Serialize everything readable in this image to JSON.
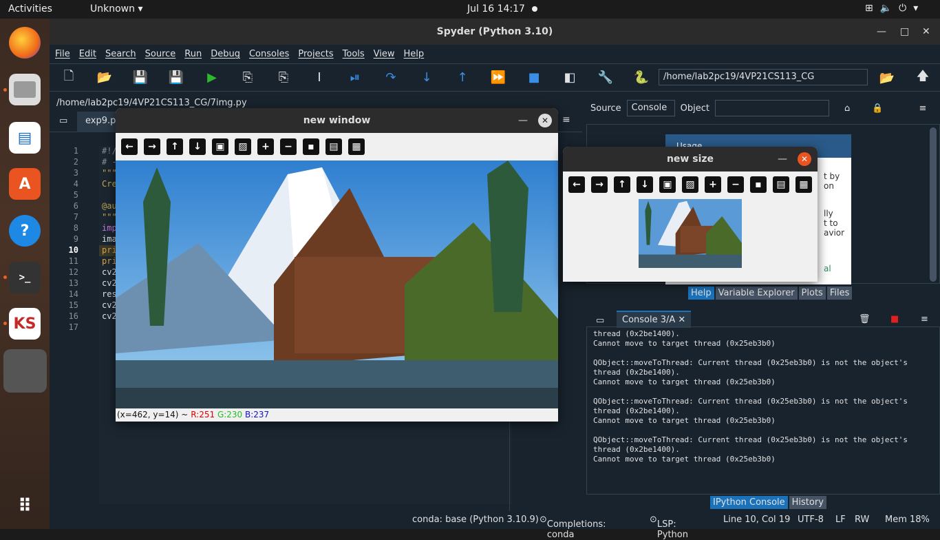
{
  "topbar": {
    "activities": "Activities",
    "app_menu": "Unknown ▾",
    "clock": "Jul 16  14:17"
  },
  "window": {
    "title": "Spyder (Python 3.10)"
  },
  "menu": [
    "File",
    "Edit",
    "Search",
    "Source",
    "Run",
    "Debug",
    "Consoles",
    "Projects",
    "Tools",
    "View",
    "Help"
  ],
  "toolbar": {
    "path": "/home/lab2pc19/4VP21CS113_CG"
  },
  "editor": {
    "filepath": "/home/lab2pc19/4VP21CS113_CG/7img.py",
    "tab": "exp9.py",
    "line_numbers": [
      "1",
      "2",
      "3",
      "4",
      "5",
      "6",
      "7",
      "8",
      "9",
      "10",
      "11",
      "12",
      "13",
      "14",
      "15",
      "16",
      "17"
    ],
    "lines": [
      "#!/",
      "# -",
      "\"\"\"",
      "Cre",
      "",
      "@au",
      "\"\"\"",
      "imp",
      "ima",
      "pri",
      "pri",
      "cv2",
      "cv2",
      "res",
      "cv2",
      "cv2",
      ""
    ]
  },
  "help": {
    "source_label": "Source",
    "source_value": "Console",
    "object_label": "Object",
    "usage": "Usage",
    "frag1": "t by",
    "frag2": "on",
    "frag3": "lly",
    "frag4": "t to",
    "frag5": "avior",
    "frag6": "al",
    "tabs": [
      "Help",
      "Variable Explorer",
      "Plots",
      "Files"
    ]
  },
  "console": {
    "tab": "Console 3/A",
    "text": "thread (0x2be1400).\nCannot move to target thread (0x25eb3b0)\n\nQObject::moveToThread: Current thread (0x25eb3b0) is not the object's\nthread (0x2be1400).\nCannot move to target thread (0x25eb3b0)\n\nQObject::moveToThread: Current thread (0x25eb3b0) is not the object's\nthread (0x2be1400).\nCannot move to target thread (0x25eb3b0)\n\nQObject::moveToThread: Current thread (0x25eb3b0) is not the object's\nthread (0x2be1400).\nCannot move to target thread (0x25eb3b0)",
    "tabs": [
      "IPython Console",
      "History"
    ]
  },
  "status": {
    "conda": "conda: base (Python 3.10.9)",
    "completions": "Completions: conda",
    "lsp": "LSP: Python",
    "pos": "Line 10, Col 19",
    "enc": "UTF-8",
    "eol": "LF",
    "rw": "RW",
    "mem": "Mem 18%"
  },
  "cv_window1": {
    "title": "new window",
    "coords": "(x=462, y=14) ~",
    "r": "R:251",
    "g": "G:230",
    "b": "B:237"
  },
  "cv_window2": {
    "title": "new size"
  }
}
